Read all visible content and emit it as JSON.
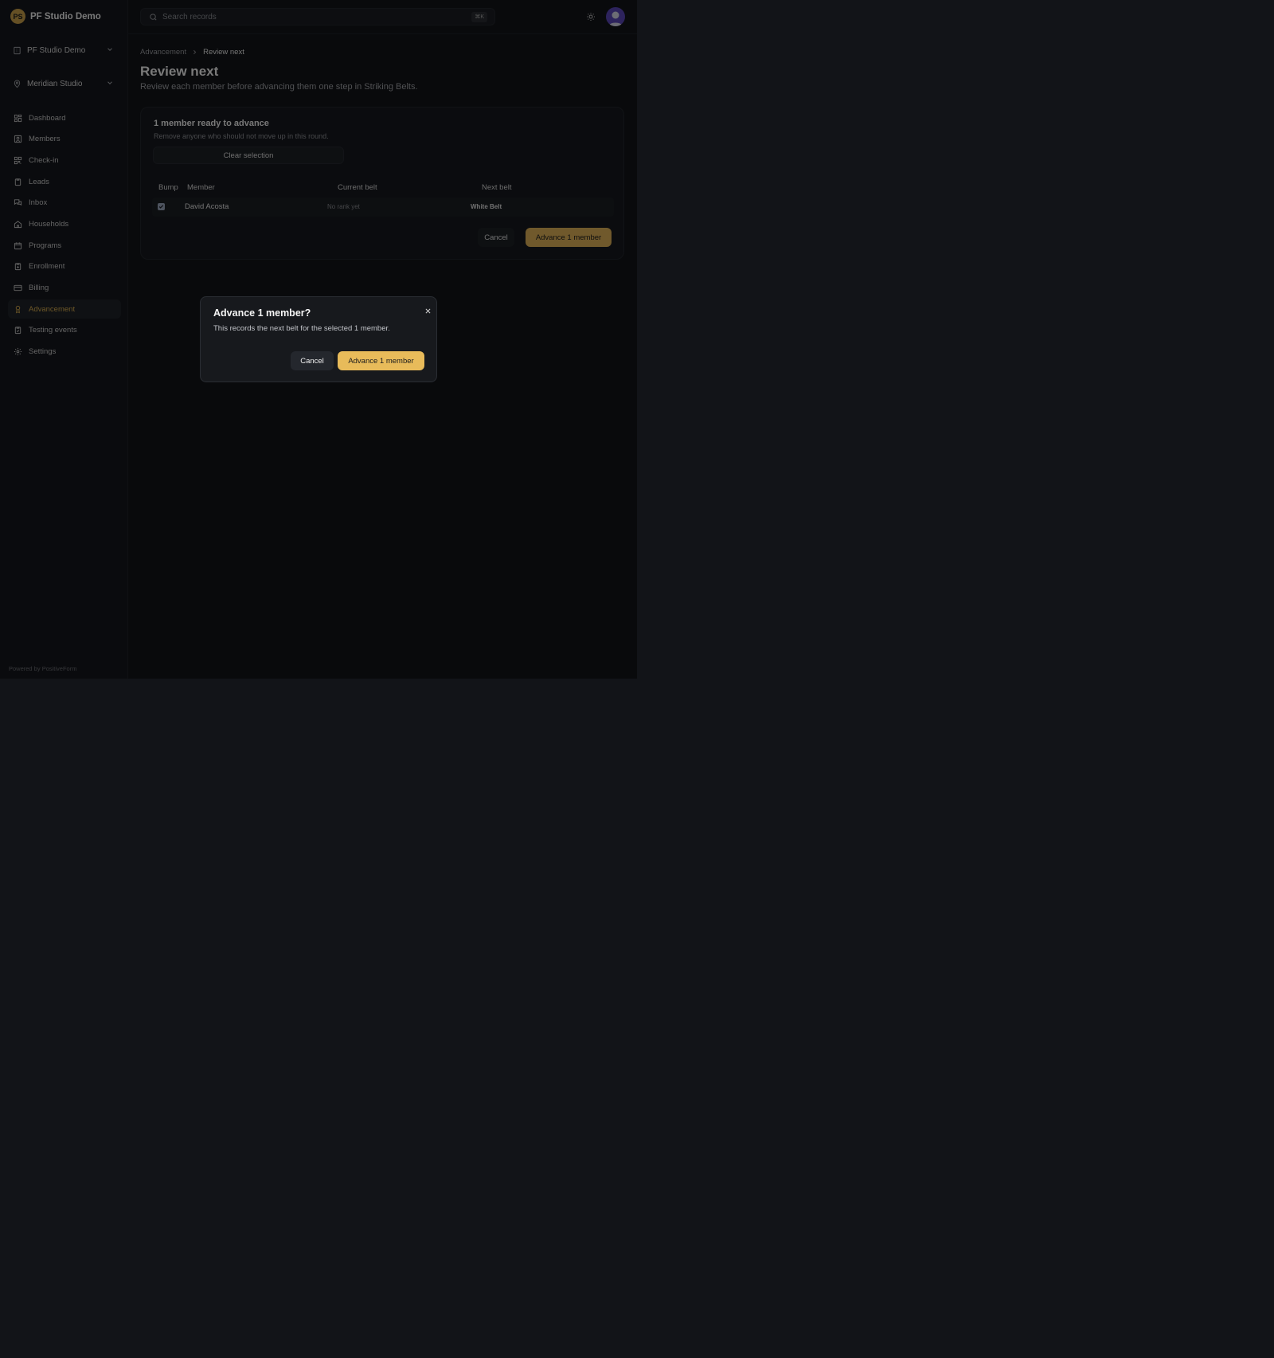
{
  "brand": {
    "logo_initials": "PS",
    "name": "PF Studio Demo"
  },
  "switchers": {
    "organization": "PF Studio Demo",
    "location": "Meridian Studio"
  },
  "nav": {
    "items": [
      {
        "label": "Dashboard",
        "icon": "dashboard-icon"
      },
      {
        "label": "Members",
        "icon": "members-icon"
      },
      {
        "label": "Check-in",
        "icon": "qr-code-icon"
      },
      {
        "label": "Leads",
        "icon": "clipboard-icon"
      },
      {
        "label": "Inbox",
        "icon": "chat-icon"
      },
      {
        "label": "Households",
        "icon": "home-icon"
      },
      {
        "label": "Programs",
        "icon": "calendar-icon"
      },
      {
        "label": "Enrollment",
        "icon": "clipboard-plus-icon"
      },
      {
        "label": "Billing",
        "icon": "credit-card-icon"
      },
      {
        "label": "Advancement",
        "icon": "award-icon"
      },
      {
        "label": "Testing events",
        "icon": "clipboard-check-icon"
      },
      {
        "label": "Settings",
        "icon": "gear-icon"
      }
    ],
    "active": "Advancement"
  },
  "footer": {
    "powered_by": "Powered by PositiveForm"
  },
  "search": {
    "placeholder": "Search records",
    "shortcut": "⌘K"
  },
  "breadcrumb": {
    "parent": "Advancement",
    "current": "Review next"
  },
  "page": {
    "title": "Review next",
    "subtitle": "Review each member before advancing them one step in Striking Belts."
  },
  "card": {
    "title": "1 member ready to advance",
    "subtitle": "Remove anyone who should not move up in this round.",
    "clear_label": "Clear selection",
    "columns": [
      "Bump",
      "Member",
      "Current belt",
      "Next belt"
    ],
    "rows": [
      {
        "checked": true,
        "member": "David Acosta",
        "current_belt": "No rank yet",
        "next_belt": "White Belt"
      }
    ],
    "cancel_label": "Cancel",
    "advance_label": "Advance 1 member"
  },
  "dialog": {
    "title": "Advance 1 member?",
    "description": "This records the next belt for the selected 1 member.",
    "cancel_label": "Cancel",
    "confirm_label": "Advance 1 member"
  },
  "colors": {
    "accent": "#e0b358",
    "active_nav_text": "#d9ae4f",
    "background": "#121418",
    "avatar": "#5a47b8"
  }
}
